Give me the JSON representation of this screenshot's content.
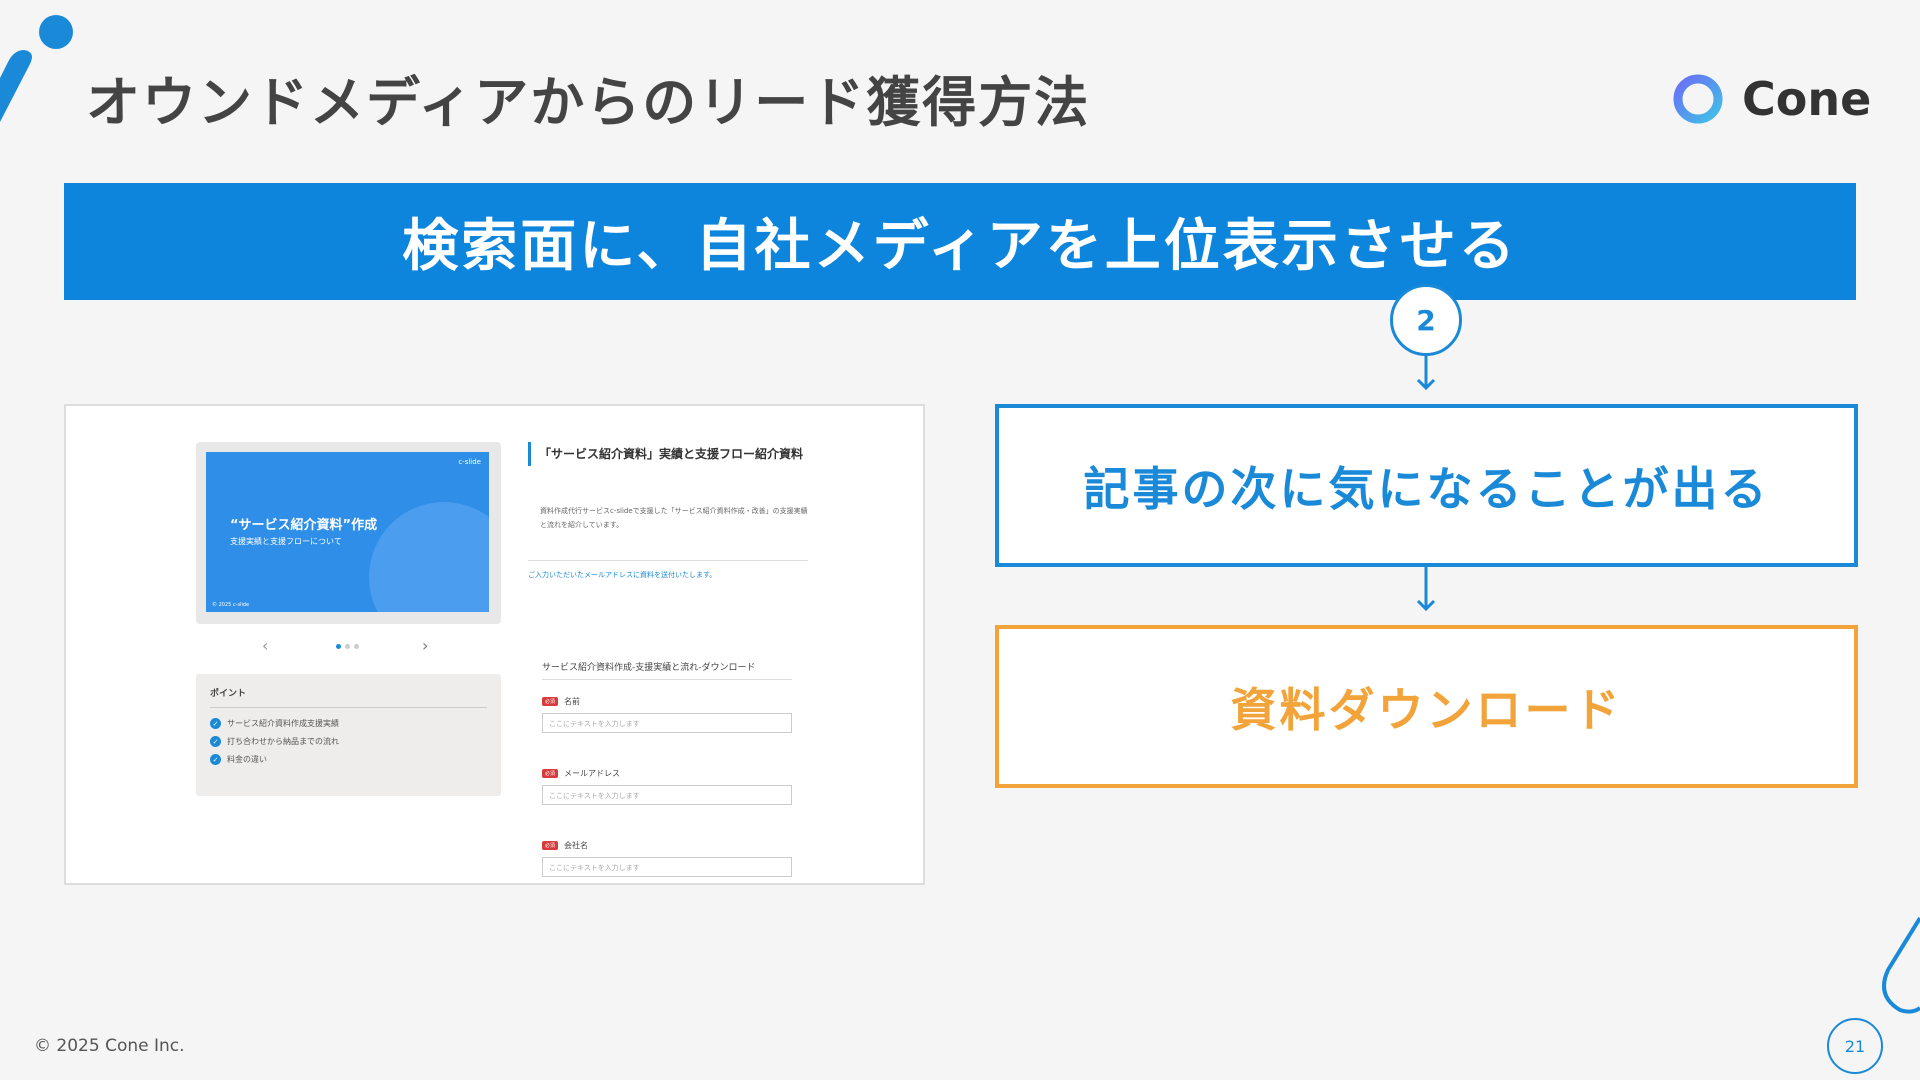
{
  "header": {
    "title": "オウンドメディアからのリード獲得方法",
    "logo_text": "Cone"
  },
  "banner": {
    "text": "検索面に、自社メディアを上位表示させる"
  },
  "flow": {
    "step_number": "2",
    "step1_text": "記事の次に気になることが出る",
    "step2_text": "資料ダウンロード"
  },
  "screenshot": {
    "thumb_brand": "c-slide",
    "thumb_title": "“サービス紹介資料”作成",
    "thumb_subtitle": "支援実績と支援フローについて",
    "thumb_footer": "© 2025 c-slide",
    "points_heading": "ポイント",
    "points": [
      "サービス紹介資料作成支援実績",
      "打ち合わせから納品までの流れ",
      "料金の違い"
    ],
    "info_title": "「サービス紹介資料」実績と支援フロー紹介資料",
    "info_desc": "資料作成代行サービスc-slideで支援した「サービス紹介資料作成・改善」の支援実績と流れを紹介しています。",
    "info_note": "ご入力いただいたメールアドレスに資料を送付いたします。",
    "form_title": "サービス紹介資料作成-支援実績と流れ-ダウンロード",
    "required_label": "必須",
    "fields": [
      {
        "label": "名前",
        "placeholder": "ここにテキストを入力します"
      },
      {
        "label": "メールアドレス",
        "placeholder": "ここにテキストを入力します"
      },
      {
        "label": "会社名",
        "placeholder": "ここにテキストを入力します"
      }
    ]
  },
  "footer": {
    "copyright": "© 2025 Cone Inc.",
    "page_number": "21"
  },
  "colors": {
    "primary_blue": "#0d85dd",
    "accent_orange": "#f2a33a",
    "background": "#f5f5f5"
  }
}
